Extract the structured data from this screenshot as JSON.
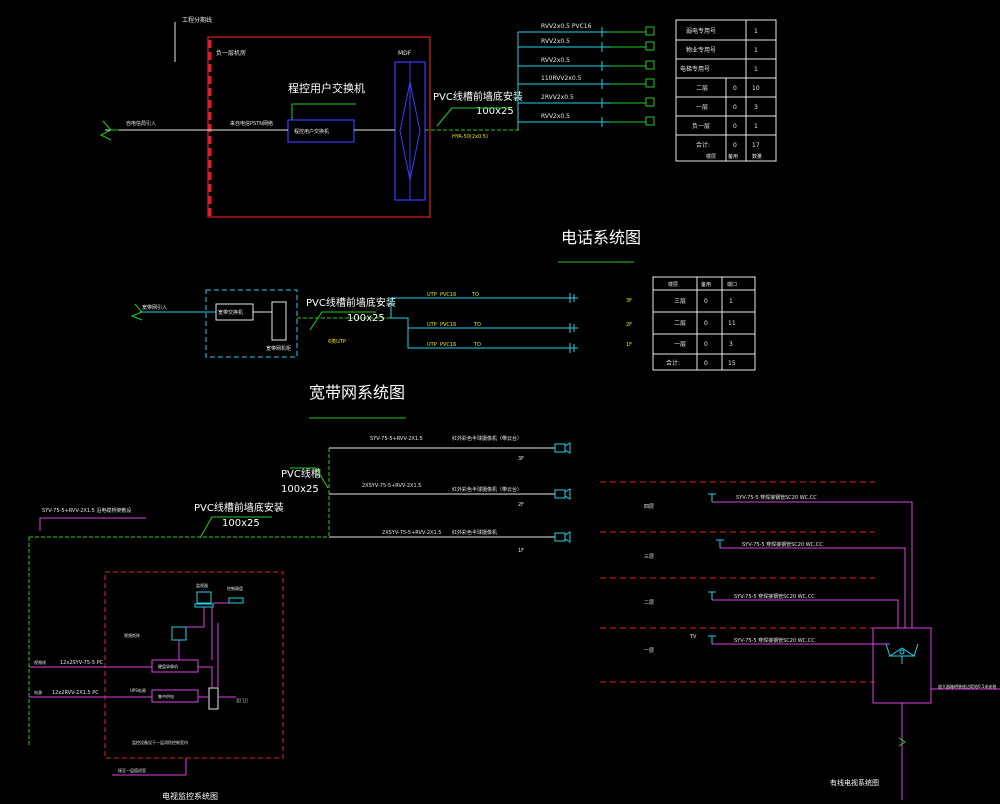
{
  "colors": {
    "background": "#000000",
    "red_dashed": "#e02020",
    "cyan": "#22d3e6",
    "green": "#22cc22",
    "magenta": "#e040e0",
    "blue": "#3a3aff",
    "white": "#ffffff",
    "yellow": "#e6e600"
  },
  "phone": {
    "title": "电话系统图",
    "building_label": "工程分期线",
    "room_label": "负一层机房",
    "pbx_label": "程控用户交换机",
    "mdf_label": "MDF",
    "module_label": "程控用户交换机",
    "incoming_label": "自电信局引入",
    "cable_label": "来自电信PSTN网络",
    "trunk_label": "PVC线槽前墙底安装",
    "trunk_size": "100x25",
    "hyv_label": "HYA-50(2x0.5)",
    "branches": [
      "RVV2x0.5  PVC16",
      "RVV2x0.5",
      "RVV2x0.5",
      "110RVV2x0.5",
      "2RVV2x0.5",
      "RVV2x0.5"
    ],
    "table": {
      "rows": [
        {
          "c1": "弱电专用号",
          "c2": "",
          "c3": "1"
        },
        {
          "c1": "物业专用号",
          "c2": "",
          "c3": "1"
        },
        {
          "c1": "电梯专用号",
          "c2": "",
          "c3": "1"
        },
        {
          "c1": "二层",
          "c2": "0",
          "c3": "10"
        },
        {
          "c1": "一层",
          "c2": "0",
          "c3": "3"
        },
        {
          "c1": "负一层",
          "c2": "0",
          "c3": "1"
        },
        {
          "c1": "合计:",
          "c2": "0",
          "c3": "17"
        }
      ],
      "footer": [
        "楼层",
        "备用",
        "数量"
      ]
    }
  },
  "broadband": {
    "title": "宽带网系统图",
    "incoming_label": "宽带网引入",
    "switch_label": "宽带交换机",
    "rack_label": "宽带网机柜",
    "trunk_label": "PVC线槽前墙底安装",
    "trunk_size": "100x25",
    "cable_label": "6类UTP",
    "branches": [
      {
        "a": "UTP",
        "b": "PVC16",
        "c": "TO"
      },
      {
        "a": "UTP",
        "b": "PVC16",
        "c": "TO"
      },
      {
        "a": "UTP",
        "b": "PVC16",
        "c": "TO"
      }
    ],
    "table": {
      "header": [
        "楼层",
        "备用",
        "端口"
      ],
      "rows": [
        {
          "c1": "三层",
          "c2": "0",
          "c3": "1"
        },
        {
          "c1": "二层",
          "c2": "0",
          "c3": "11"
        },
        {
          "c1": "一层",
          "c2": "0",
          "c3": "3"
        },
        {
          "c1": "合计:",
          "c2": "0",
          "c3": "15"
        }
      ]
    },
    "side_marks": [
      "3F",
      "2F",
      "1F"
    ]
  },
  "cctv": {
    "title": "电视监控系统图",
    "trunk_label": "PVC线槽",
    "trunk_size": "100x25",
    "trunk2_label": "PVC线槽前墙底安装",
    "trunk2_size": "100x25",
    "top_cable": "SYV-75-5+RVV-2X1.5  沿电缆桥架敷设",
    "feeders": [
      {
        "cable": "SYV-75-5+RVV-2X1.5",
        "note": "红外彩色半球摄像机（带云台）",
        "floor": "3F"
      },
      {
        "cable": "2XSYV-75-5+RVV-2X1.5",
        "note": "红外彩色半球摄像机（带云台）",
        "floor": "2F"
      },
      {
        "cable": "2XSYV-75-5+RVV-2X1.5",
        "note": "红外彩色半球摄像机",
        "floor": "1F"
      }
    ],
    "left_cable_a": "12x2SYV-75-5 PC",
    "left_cable_b": "12x2RVV-2X1.5  PC",
    "left_label_a": "视频线",
    "left_label_b": "电源",
    "devices": {
      "monitor": "监视器",
      "recorder": "硬盘录像机",
      "matrix": "视频矩阵",
      "power": "集中供电",
      "keyboard": "控制键盘",
      "ups": "UPS电源",
      "out": "至门卫"
    },
    "room_note": "监控设备设于一层消防控制室内",
    "bottom_note": "接至一层值班室"
  },
  "catv": {
    "title": "有线电视系统图",
    "floors": [
      "四层",
      "三层",
      "二层",
      "一层"
    ],
    "cables": [
      "SYV-75-5  穿焊接钢管SC20  WC,CC",
      "SYV-75-5  穿焊接钢管SC20  WC,CC",
      "SYV-75-5  穿焊接钢管SC20  WC,CC",
      "SYV-75-5  穿焊接钢管SC20  WC,CC"
    ],
    "amp_note": "放大器箱明装底边距地0.5米安装",
    "tv_mark": "TV"
  }
}
